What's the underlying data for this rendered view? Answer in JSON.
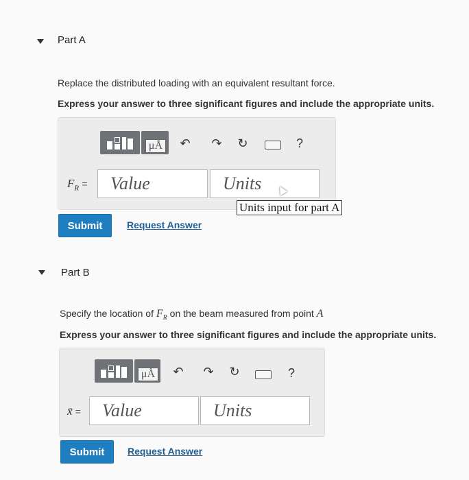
{
  "partA": {
    "title": "Part A",
    "prompt": "Replace the distributed loading with an equivalent resultant force.",
    "instruction": "Express your answer to three significant figures and include the appropriate units.",
    "var_label": "F",
    "var_sub": "R",
    "equals": "=",
    "value_placeholder": "Value",
    "units_placeholder": "Units",
    "units_tooltip": "Units input for part A",
    "submit": "Submit",
    "request": "Request Answer"
  },
  "partB": {
    "title": "Part B",
    "prompt_pre": "Specify the location of ",
    "prompt_var": "F",
    "prompt_sub": "R",
    "prompt_post": " on the beam measured from point ",
    "prompt_point": "A",
    "instruction": "Express your answer to three significant figures and include the appropriate units.",
    "var_label": "x̄",
    "equals": "=",
    "value_placeholder": "Value",
    "units_placeholder": "Units",
    "submit": "Submit",
    "request": "Request Answer"
  },
  "toolbar": {
    "mu_label": "μÅ",
    "help": "?",
    "icons": [
      "templates-icon",
      "units-icon",
      "undo-icon",
      "redo-icon",
      "reset-icon",
      "keyboard-icon",
      "help-icon"
    ]
  },
  "colors": {
    "submit": "#1e7ec0",
    "link": "#1f5f95"
  }
}
